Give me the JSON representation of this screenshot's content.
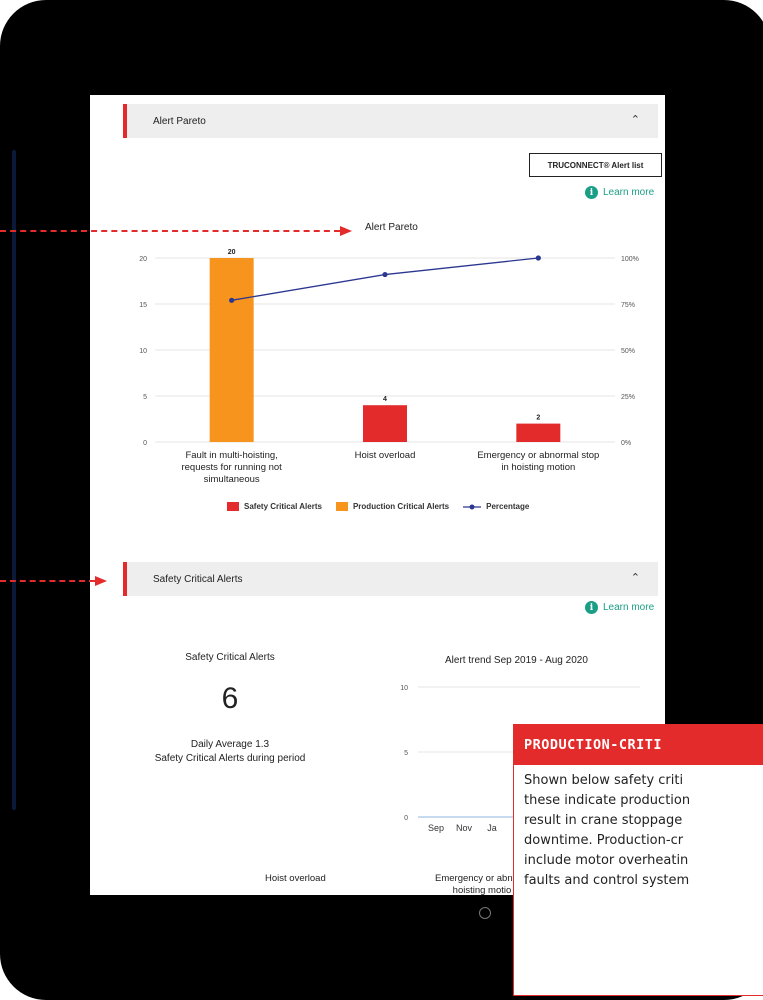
{
  "alert_pareto_section": {
    "header_title": "Alert Pareto",
    "alert_list_button": "TRUCONNECT® Alert list",
    "learn_more": "Learn more"
  },
  "safety_section": {
    "header_title": "Safety Critical Alerts",
    "learn_more": "Learn more",
    "kpi_title": "Safety Critical Alerts",
    "kpi_value": "6",
    "kpi_sub_line1": "Daily Average 1.3",
    "kpi_sub_line2": "Safety Critical Alerts during period",
    "trend_title": "Alert trend Sep 2019 - Aug 2020",
    "bottom_label_1": "Hoist overload",
    "bottom_label_2_line1": "Emergency or abnorm",
    "bottom_label_2_line2": "hoisting motio"
  },
  "popup": {
    "title": "PRODUCTION-CRITI",
    "lines": [
      "Shown below safety criti",
      "these indicate production",
      "result in crane stoppage",
      "downtime. Production-cr",
      "include motor overheatin",
      "faults and control system"
    ]
  },
  "colors": {
    "safety": "#e32b2b",
    "production": "#f7941d",
    "percentage": "#2c3791",
    "learn_more": "#1a9f86"
  },
  "icons": [
    "chevron-up-icon",
    "info-icon",
    "arrow-right-icon"
  ],
  "chart_data": [
    {
      "type": "bar",
      "title": "Alert Pareto",
      "categories": [
        "Fault in multi-hoisting, requests for running not simultaneous",
        "Hoist overload",
        "Emergency or abnormal stop in hoisting motion"
      ],
      "category_lines": [
        [
          "Fault in multi-hoisting,",
          "requests for running not",
          "simultaneous"
        ],
        [
          "Hoist overload"
        ],
        [
          "Emergency or abnormal stop",
          "in hoisting motion"
        ]
      ],
      "series": [
        {
          "name": "Safety Critical Alerts",
          "values": [
            0,
            4,
            2
          ]
        },
        {
          "name": "Production Critical Alerts",
          "values": [
            20,
            0,
            0
          ]
        },
        {
          "name": "Percentage",
          "type": "line",
          "axis": "right",
          "values": [
            77,
            91,
            100
          ]
        }
      ],
      "data_labels": [
        "20",
        "4",
        "2"
      ],
      "ylim": [
        0,
        20
      ],
      "yticks": [
        "0",
        "5",
        "10",
        "15",
        "20"
      ],
      "y2ticks": [
        "0%",
        "25%",
        "50%",
        "75%",
        "100%"
      ],
      "legend": [
        "Safety Critical Alerts",
        "Production Critical Alerts",
        "Percentage"
      ],
      "legend_position": "bottom",
      "grid": true
    },
    {
      "type": "line",
      "title": "Alert trend Sep 2019 - Aug 2020",
      "x": [
        "Sep",
        "Nov",
        "Ja"
      ],
      "ylim": [
        0,
        10
      ],
      "yticks": [
        "0",
        "5",
        "10"
      ],
      "series": [],
      "grid": true
    }
  ]
}
